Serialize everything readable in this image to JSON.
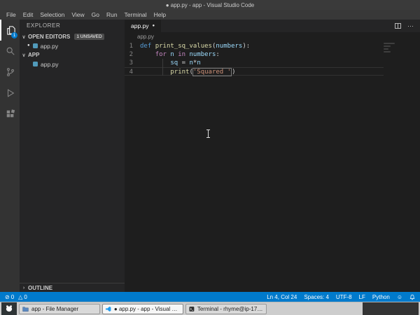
{
  "icons": {
    "chevron_down": "∨",
    "chevron_right": "›",
    "more": "⋯",
    "dirty_dot": "●",
    "error": "⊘",
    "warning": "△",
    "smiley": "☺"
  },
  "title_bar": {
    "title": "● app.py - app - Visual Studio Code"
  },
  "menu_bar": {
    "items": [
      "File",
      "Edit",
      "Selection",
      "View",
      "Go",
      "Run",
      "Terminal",
      "Help"
    ]
  },
  "activity_bar": {
    "explorer_badge": "1"
  },
  "sidebar": {
    "title": "EXPLORER",
    "open_editors": {
      "label": "OPEN EDITORS",
      "badge": "1 UNSAVED"
    },
    "open_editor_items": [
      {
        "dirty": "●",
        "name": "app.py"
      }
    ],
    "folder": {
      "label": "APP"
    },
    "folder_items": [
      {
        "name": "app.py"
      }
    ],
    "outline": {
      "label": "OUTLINE"
    }
  },
  "editor": {
    "tab": {
      "label": "app.py",
      "dirty": "●"
    },
    "breadcrumb": "app.py",
    "code": {
      "lines": [
        {
          "num": "1",
          "tokens": [
            {
              "t": "def ",
              "c": "kw"
            },
            {
              "t": "print_sq_values",
              "c": "fn"
            },
            {
              "t": "(",
              "c": "p"
            },
            {
              "t": "numbers",
              "c": "var"
            },
            {
              "t": "):",
              "c": "p"
            }
          ]
        },
        {
          "num": "2",
          "tokens": [
            {
              "t": "    ",
              "c": "p"
            },
            {
              "t": "for",
              "c": "ctrl"
            },
            {
              "t": " ",
              "c": "p"
            },
            {
              "t": "n",
              "c": "var"
            },
            {
              "t": " ",
              "c": "p"
            },
            {
              "t": "in",
              "c": "ctrl"
            },
            {
              "t": " ",
              "c": "p"
            },
            {
              "t": "numbers",
              "c": "var"
            },
            {
              "t": ":",
              "c": "p"
            }
          ]
        },
        {
          "num": "3",
          "tokens": [
            {
              "t": "        ",
              "c": "p"
            },
            {
              "t": "sq",
              "c": "var"
            },
            {
              "t": " = ",
              "c": "p"
            },
            {
              "t": "n",
              "c": "var"
            },
            {
              "t": "*",
              "c": "p"
            },
            {
              "t": "n",
              "c": "var"
            }
          ]
        },
        {
          "num": "4",
          "current": true,
          "tokens": [
            {
              "t": "        ",
              "c": "p"
            },
            {
              "t": "print",
              "c": "fn"
            },
            {
              "t": "(",
              "c": "p"
            },
            {
              "t": "'Squared '",
              "c": "str",
              "box": true,
              "cursor_after": true
            },
            {
              "t": ")",
              "c": "p"
            }
          ]
        }
      ]
    }
  },
  "status_bar": {
    "errors": "0",
    "warnings": "0",
    "cursor": "Ln 4, Col 24",
    "indent": "Spaces: 4",
    "encoding": "UTF-8",
    "eol": "LF",
    "language": "Python"
  },
  "taskbar": {
    "windows": [
      {
        "label": "app - File Manager"
      },
      {
        "label": "● app.py - app - Visual Studi..."
      },
      {
        "label": "Terminal - rhyme@ip-172-31..."
      }
    ]
  }
}
